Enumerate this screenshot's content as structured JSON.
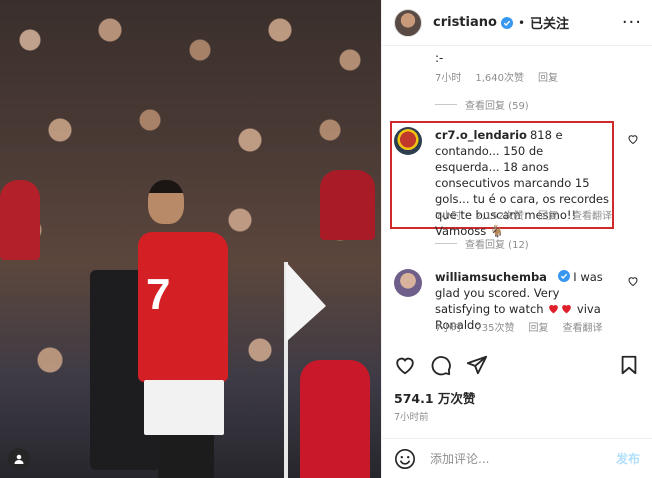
{
  "header": {
    "username": "cristiano",
    "separator": "•",
    "follow_status": "已关注",
    "more": "···"
  },
  "comments_area": {
    "prev_comment_tail": ":-",
    "prev_meta": {
      "time": "7小时",
      "likes": "1,640次赞",
      "reply": "回复"
    },
    "prev_view_replies": "查看回复 (59)",
    "highlighted_comment": {
      "username": "cr7.o_lendario",
      "text": "818 e contando... 150 de esquerda... 18 anos consecutivos marcando 15 gols... tu é o cara, os recordes que te buscam mesmo!! Vamooss 🐐",
      "time": "7小时",
      "likes": "2,152次赞",
      "reply": "回复",
      "translate": "查看翻译",
      "view_replies": "查看回复 (12)"
    },
    "second_comment": {
      "username": "williamsuchemba",
      "text_before": "I was glad you scored. Very satisfying to watch",
      "text_after": "viva Ronaldo",
      "time": "7小时",
      "likes": "735次赞",
      "reply": "回复",
      "translate": "查看翻译"
    }
  },
  "post": {
    "likes": "574.1 万次赞",
    "time": "7小时前"
  },
  "add_comment": {
    "placeholder": "添加评论...",
    "post_button": "发布"
  },
  "photo": {
    "shirt_number": "7"
  },
  "colors": {
    "highlight_border": "#d0292c",
    "verified": "#3897f0",
    "heart": "#ed4956",
    "post_button": "#b2dffc"
  }
}
